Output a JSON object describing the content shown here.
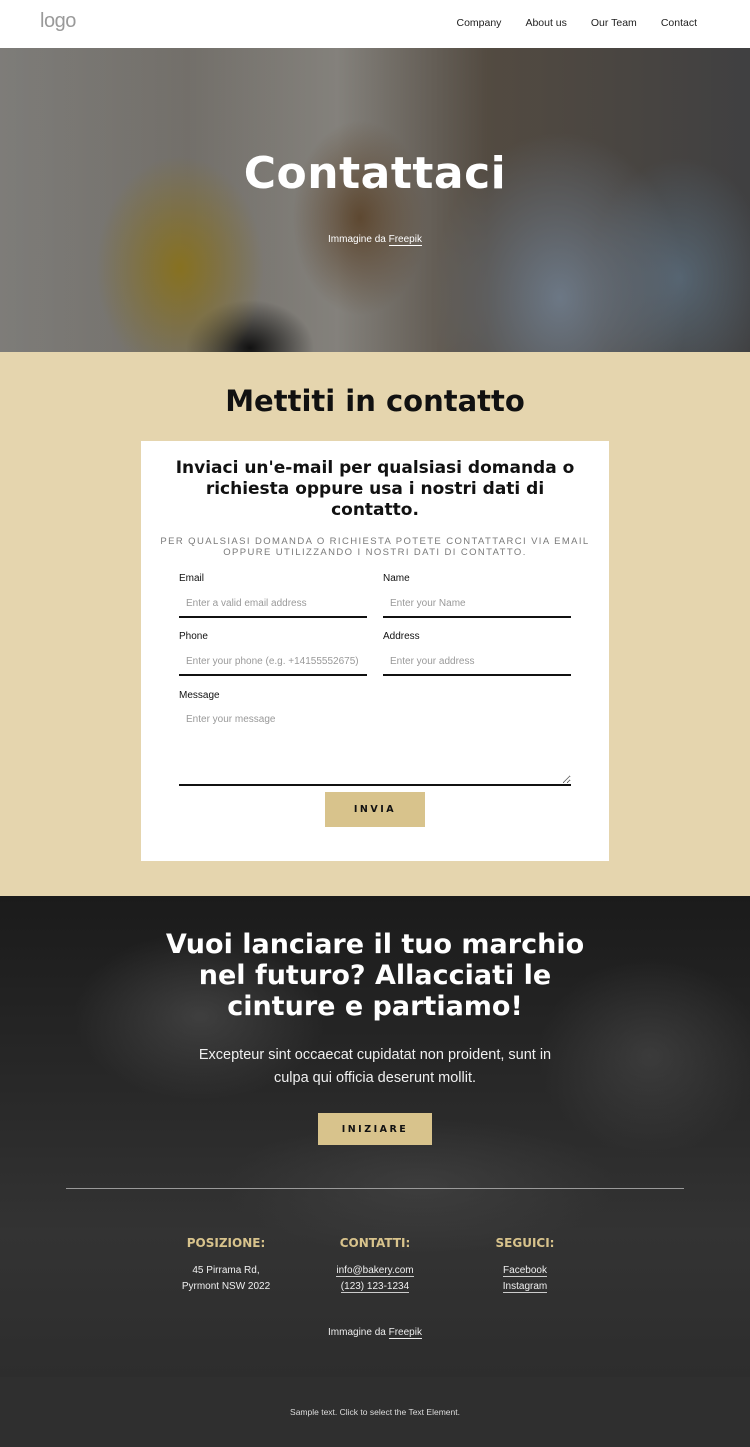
{
  "header": {
    "logo": "logo",
    "nav": [
      {
        "label": "Company"
      },
      {
        "label": "About us"
      },
      {
        "label": "Our Team"
      },
      {
        "label": "Contact"
      }
    ]
  },
  "hero": {
    "title": "Contattaci",
    "credit_prefix": "Immagine da ",
    "credit_link": "Freepik"
  },
  "contact": {
    "title": "Mettiti in contatto",
    "card_title": "Inviaci un'e-mail per qualsiasi domanda o richiesta oppure usa i nostri dati di contatto.",
    "card_subtitle": "PER QUALSIASI DOMANDA O RICHIESTA POTETE CONTATTARCI VIA EMAIL OPPURE UTILIZZANDO I NOSTRI DATI DI CONTATTO.",
    "form": {
      "email": {
        "label": "Email",
        "placeholder": "Enter a valid email address",
        "value": ""
      },
      "name": {
        "label": "Name",
        "placeholder": "Enter your Name",
        "value": ""
      },
      "phone": {
        "label": "Phone",
        "placeholder": "Enter your phone (e.g. +14155552675)",
        "value": ""
      },
      "address": {
        "label": "Address",
        "placeholder": "Enter your address",
        "value": ""
      },
      "message": {
        "label": "Message",
        "placeholder": "Enter your message",
        "value": ""
      },
      "submit_label": "INVIA"
    }
  },
  "cta": {
    "title": "Vuoi lanciare il tuo marchio nel futuro? Allacciati le cinture e partiamo!",
    "text": "Excepteur sint occaecat cupidatat non proident, sunt in culpa qui officia deserunt mollit.",
    "button_label": "INIZIARE"
  },
  "footer": {
    "columns": {
      "position": {
        "heading": "POSIZIONE:",
        "line1": "45 Pirrama Rd,",
        "line2": "Pyrmont NSW 2022"
      },
      "contacts": {
        "heading": "CONTATTI:",
        "email": "info@bakery.com",
        "phone": "(123) 123-1234"
      },
      "follow": {
        "heading": "SEGUICI:",
        "facebook": "Facebook",
        "instagram": "Instagram"
      }
    },
    "credit_prefix": "Immagine da ",
    "credit_link": "Freepik",
    "bottom_text": "Sample text. Click to select the Text Element."
  },
  "colors": {
    "accent": "#d8c38c",
    "section_bg": "#e5d5ae",
    "dark_bg": "#2f2f2f"
  }
}
